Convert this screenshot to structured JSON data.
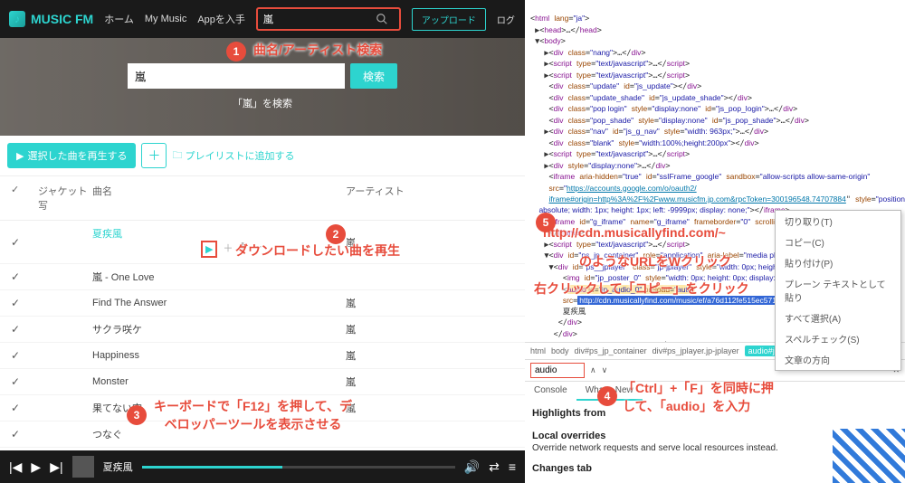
{
  "topbar": {
    "logo_text": "MUSIC FM",
    "nav": [
      "ホーム",
      "My Music",
      "Appを入手"
    ],
    "search_value": "嵐",
    "upload_label": "アップロード",
    "login_label": "ログ"
  },
  "hero": {
    "input_value": "嵐",
    "search_btn": "検索",
    "subtitle": "「嵐」を検索"
  },
  "toolbar": {
    "play_selected": "選択した曲を再生する",
    "add_playlist": "プレイリストに追加する"
  },
  "table": {
    "col_check": "✓",
    "col_art": "ジャケット写",
    "col_song": "曲名",
    "col_artist": "アーティスト"
  },
  "songs": [
    {
      "name": "夏疾風",
      "artist": "嵐",
      "active": true,
      "icons": true
    },
    {
      "name": "嵐 - One Love",
      "artist": ""
    },
    {
      "name": "Find The Answer",
      "artist": "嵐"
    },
    {
      "name": "サクラ咲ケ",
      "artist": "嵐"
    },
    {
      "name": "Happiness",
      "artist": "嵐"
    },
    {
      "name": "Monster",
      "artist": "嵐"
    },
    {
      "name": "果てない空",
      "artist": "嵐"
    },
    {
      "name": "つなぐ",
      "artist": ""
    }
  ],
  "player": {
    "now_playing": "夏疾風"
  },
  "annotations": {
    "a1": "曲名/アーティスト検索",
    "a2": "ダウンロードしたい曲を再生",
    "a3a": "キーボードで「F12」を押して、デ",
    "a3b": "ベロッパーツールを表示させる",
    "a4a": "「Ctrl」+「F」を同時に押",
    "a4b": "して、「audio」を入力",
    "a5a": "http://cdn.musicallyfind.com/~",
    "a5b": "のようなURLをWクリック",
    "a5c": "右クリックして「コピー」をクリック"
  },
  "devtools": {
    "context_menu": [
      "切り取り(T)",
      "コピー(C)",
      "貼り付け(P)",
      "プレーン テキストとして貼り",
      "すべて選択(A)",
      "スペルチェック(S)",
      "文章の方向"
    ],
    "crumbs": [
      "html",
      "body",
      "div#ps_jp_container",
      "div#ps_jplayer.jp-jplayer",
      "audio#jp_audio_0"
    ],
    "find_value": "audio",
    "tabs": [
      "Console",
      "What's New"
    ],
    "highlight_title": "Highlights from",
    "overrides_title": "Local overrides",
    "overrides_text": "Override network requests and serve local resources instead.",
    "changes_title": "Changes tab",
    "audio_url": "http://cdn.musicallyfind.com/music/ef/a76d112fe515ec571"
  }
}
